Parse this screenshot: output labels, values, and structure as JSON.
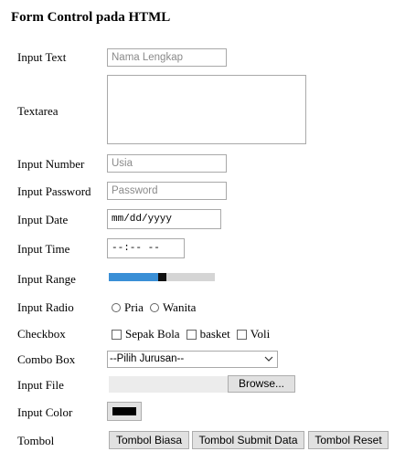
{
  "page": {
    "title": "Form Control pada HTML"
  },
  "labels": {
    "input_text": "Input Text",
    "textarea": "Textarea",
    "input_number": "Input Number",
    "input_password": "Input Password",
    "input_date": "Input Date",
    "input_time": "Input Time",
    "input_range": "Input Range",
    "input_radio": "Input Radio",
    "checkbox": "Checkbox",
    "combo_box": "Combo Box",
    "input_file": "Input File",
    "input_color": "Input Color",
    "tombol": "Tombol"
  },
  "fields": {
    "text_placeholder": "Nama Lengkap",
    "number_placeholder": "Usia",
    "password_placeholder": "Password",
    "date_value": "mm/dd/yyyy",
    "time_value": "--:-- --",
    "range_value": 0.5,
    "color_value": "#000000"
  },
  "radio_options": [
    "Pria",
    "Wanita"
  ],
  "checkbox_options": [
    "Sepak Bola",
    "basket",
    "Voli"
  ],
  "combo": {
    "selected": "--Pilih Jurusan--"
  },
  "file": {
    "browse_label": "Browse..."
  },
  "buttons": {
    "biasa": "Tombol Biasa",
    "submit": "Tombol Submit Data",
    "reset": "Tombol Reset"
  },
  "colors": {
    "range_fill": "#3a8fd6",
    "range_track": "#d5d5d5"
  }
}
